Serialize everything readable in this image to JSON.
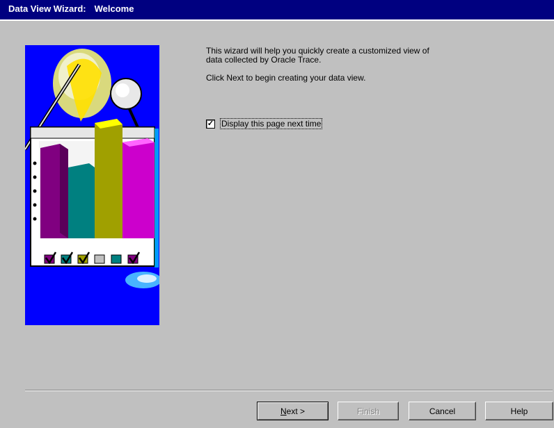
{
  "window": {
    "title": "Data View Wizard:",
    "subtitle": "Welcome"
  },
  "content": {
    "intro_line1": "This wizard will help you quickly create a customized view of\ndata collected by Oracle Trace.",
    "intro_line2": "Click Next to begin creating your data view.",
    "checkbox": {
      "label": "Display this page next time",
      "checked": true
    }
  },
  "buttons": {
    "next": "Next >",
    "finish": "Finish",
    "cancel": "Cancel",
    "help": "Help"
  },
  "colors": {
    "titlebar": "#000080",
    "illustration_bg": "#0000ff",
    "dialog_bg": "#c0c0c0"
  }
}
